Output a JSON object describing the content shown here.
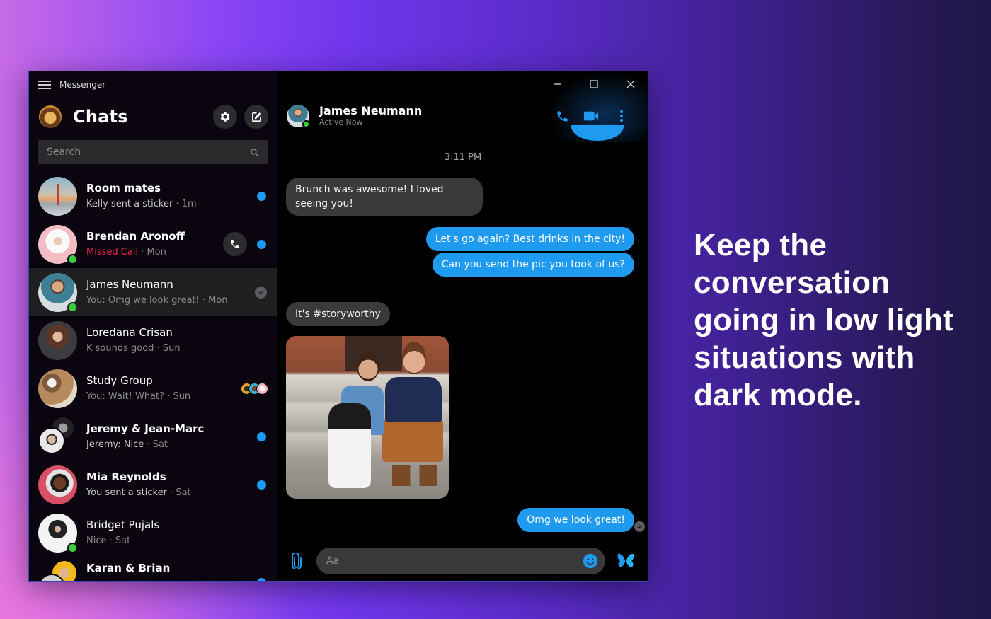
{
  "app": {
    "name": "Messenger",
    "window_controls": {
      "minimize": "minimize",
      "maximize": "maximize",
      "close": "close"
    }
  },
  "sidebar": {
    "title": "Chats",
    "search_placeholder": "Search",
    "chats": [
      {
        "name": "Room mates",
        "preview": "Kelly sent a sticker",
        "time": "1m",
        "unread": true,
        "online": false,
        "bold": true
      },
      {
        "name": "Brendan Aronoff",
        "preview": "Missed Call",
        "preview_style": "missed",
        "time": "Mon",
        "unread": true,
        "online": true,
        "bold": true,
        "call_button": true
      },
      {
        "name": "James Neumann",
        "preview": "You: Omg we look great!",
        "time": "Mon",
        "unread": false,
        "online": true,
        "bold": false,
        "selected": true,
        "seen": true
      },
      {
        "name": "Loredana Crisan",
        "preview": "K sounds good",
        "time": "Sun",
        "unread": false,
        "online": false,
        "bold": false
      },
      {
        "name": "Study Group",
        "preview": "You: Wait! What?",
        "time": "Sun",
        "unread": false,
        "online": false,
        "bold": false,
        "seen_by_count": 3
      },
      {
        "name": "Jeremy & Jean-Marc",
        "preview": "Jeremy: Nice",
        "time": "Sat",
        "unread": true,
        "online": false,
        "bold": true
      },
      {
        "name": "Mia Reynolds",
        "preview": "You sent a sticker",
        "time": "Sat",
        "unread": true,
        "online": false,
        "bold": true
      },
      {
        "name": "Bridget Pujals",
        "preview": "Nice",
        "time": "Sat",
        "unread": false,
        "online": true,
        "bold": false
      },
      {
        "name": "Karan & Brian",
        "preview": "",
        "time": "",
        "unread": true,
        "online": false,
        "bold": true
      }
    ]
  },
  "conversation": {
    "contact_name": "James Neumann",
    "contact_status": "Active Now",
    "timestamp": "3:11 PM",
    "messages": [
      {
        "direction": "in",
        "text": "Brunch was awesome! I loved seeing you!"
      },
      {
        "direction": "out",
        "text": "Let's go again? Best drinks in the city!"
      },
      {
        "direction": "out",
        "text": "Can you send the pic you took of us?"
      },
      {
        "direction": "in",
        "text": "It's #storyworthy"
      },
      {
        "direction": "in",
        "type": "photo",
        "description": "Couple sitting on steps with a dog"
      },
      {
        "direction": "out",
        "text": "Omg we look great!",
        "seen": true
      }
    ],
    "composer_placeholder": "Aa",
    "accent_color": "#1e9bf0"
  },
  "marketing": {
    "tagline": "Keep the conversation going in low light situations with dark mode."
  },
  "colors": {
    "accent": "#1e9bf0",
    "online": "#3ccb3c",
    "missed_call": "#f0284a",
    "incoming_bubble": "#3a3a3c"
  }
}
